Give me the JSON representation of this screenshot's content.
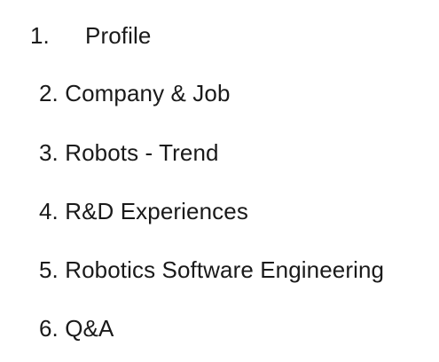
{
  "agenda": {
    "items": [
      {
        "number": "1.",
        "label": "Profile"
      },
      {
        "number": "2.",
        "label": "Company & Job"
      },
      {
        "number": "3.",
        "label": "Robots - Trend"
      },
      {
        "number": "4.",
        "label": "R&D Experiences"
      },
      {
        "number": "5.",
        "label": "Robotics Software Engineering"
      },
      {
        "number": "6.",
        "label": "Q&A"
      }
    ]
  }
}
